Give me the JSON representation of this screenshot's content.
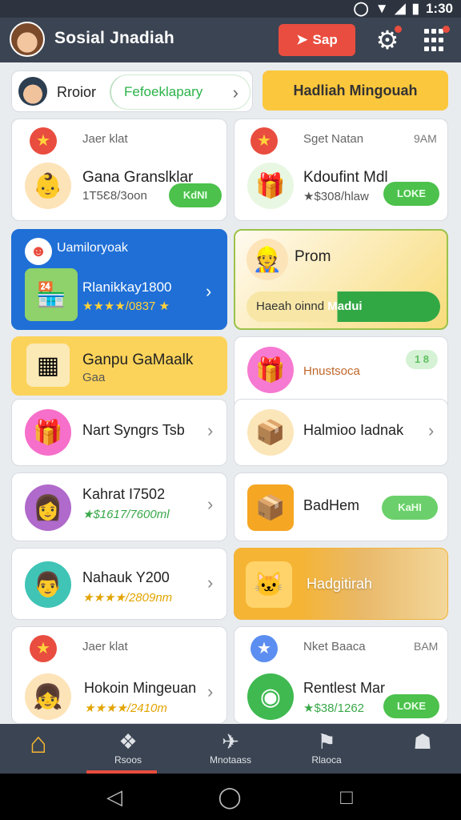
{
  "status_bar": {
    "time": "1:30"
  },
  "app_bar": {
    "title": "Sosial Jnadiah",
    "shop_label": "Sap"
  },
  "profile": {
    "name": "Rroior",
    "link_label": "Fefoeklapary"
  },
  "weekly_button": "Hadliah Mingouah",
  "cards": [
    {
      "small": "Jaer klat",
      "title": "Gana Granslklar",
      "sub": "1T5Ɛ8/3oon",
      "button": "KdNI"
    },
    {
      "small": "Sget Natan",
      "time": "9AM",
      "title": "Kdoufint Mdl",
      "sub": "★$308/hlaw",
      "button": "LOKE"
    },
    {
      "small": "Uamiloryoak",
      "title": "Rlanikkay1800",
      "sub": "★★★★/0837 ★"
    },
    {
      "title": "Prom",
      "bar_left": "Haeah oinnd",
      "bar_right": "Madui"
    },
    {
      "title": "Ganpu GaMaalk",
      "sub": "Gaa"
    },
    {
      "small": "Hnustsoca",
      "button": "1 8"
    },
    {
      "title": "Nart Syngrs Tsb"
    },
    {
      "title": "Halmioo Iadnak"
    },
    {
      "title": "Kahrat I7502",
      "sub": "★$1617/7600ml"
    },
    {
      "title": "BadHem",
      "button": "KaHI"
    },
    {
      "title": "Nahauk Y200",
      "sub": "★★★★/2809nm"
    },
    {
      "title": "Hadgitirah"
    },
    {
      "small": "Jaer klat",
      "title": "Hokoin Mingeuan",
      "sub": "★★★★/2410m"
    },
    {
      "small": "Nket Baaca",
      "time": "BAM",
      "title": "Rentlest Mar",
      "sub": "★$38/1262",
      "button": "LOKE"
    }
  ],
  "bottom_nav": [
    {
      "label": ""
    },
    {
      "label": "Rsoos"
    },
    {
      "label": "Mnotaass"
    },
    {
      "label": "Rlaoca"
    },
    {
      "label": ""
    }
  ],
  "colors": {
    "appbar": "#3b4452",
    "accent_red": "#e94d3f",
    "gold": "#fbc73c",
    "green": "#4cc14c",
    "blue": "#1f6fd6"
  }
}
